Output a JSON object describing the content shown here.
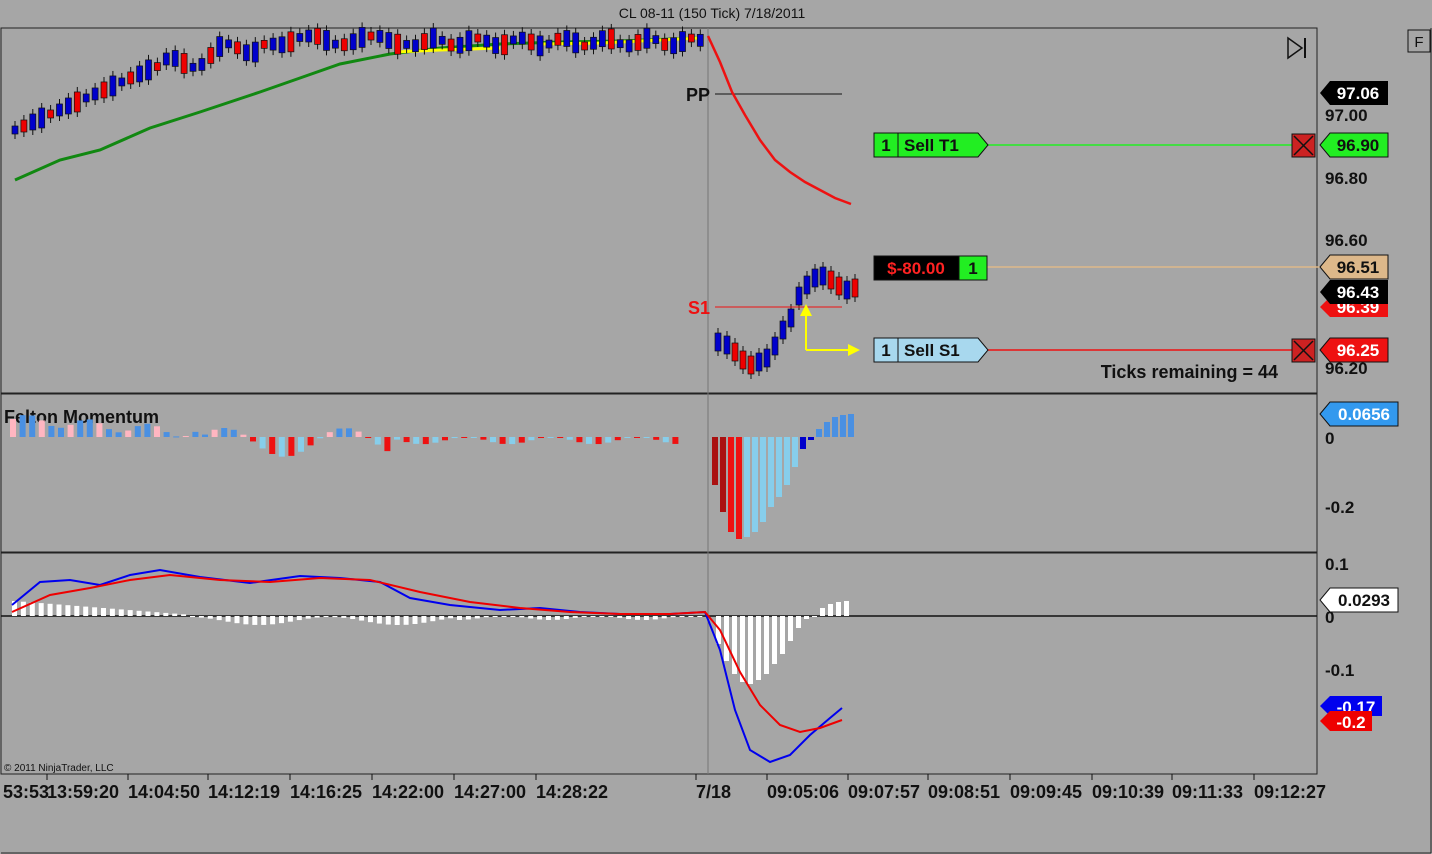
{
  "window": {
    "title": "CL 08-11 (150 Tick)  7/18/2011"
  },
  "toolbar": {
    "f_button": "F",
    "skip_icon": "skip-to-end-icon"
  },
  "price_panel": {
    "pivot_pp": "PP",
    "pivot_s1": "S1",
    "price_labels": [
      "97.00",
      "96.80",
      "96.60",
      "96.20"
    ],
    "tags": {
      "p1": "97.06",
      "target": "96.90",
      "entry": "96.51",
      "last": "96.43",
      "s1_hidden": "96.39",
      "stop": "96.25"
    },
    "order_target": {
      "qty": "1",
      "label": "Sell T1"
    },
    "order_stop": {
      "qty": "1",
      "label": "Sell S1"
    },
    "position": {
      "pnl": "$-80.00",
      "qty": "1"
    },
    "ticks_remaining": "Ticks remaining = 44",
    "colors": {
      "up": "#0000cc",
      "down": "#ee0000",
      "sma": "#118811",
      "pivot_line": "#ee1111",
      "target": "#22ee22",
      "entry": "#ddb88a"
    }
  },
  "momentum_panel": {
    "title": "Felton Momentum",
    "axis_labels": [
      "0",
      "-0.2"
    ],
    "value_tag": "0.0656"
  },
  "macd_panel": {
    "axis_labels": [
      "0.1",
      "0",
      "-0.1"
    ],
    "value_tags": {
      "hist": "0.0293",
      "macd": "-0.17",
      "signal": "-0.2"
    },
    "copyright": "© 2011 NinjaTrader, LLC"
  },
  "time_axis": {
    "labels": [
      "53:53",
      "13:59:20",
      "14:04:50",
      "14:12:19",
      "14:16:25",
      "14:22:00",
      "14:27:00",
      "14:28:22",
      "7/18",
      "09:05:06",
      "09:07:57",
      "09:08:51",
      "09:09:45",
      "09:10:39",
      "09:11:33",
      "09:12:27"
    ]
  }
}
